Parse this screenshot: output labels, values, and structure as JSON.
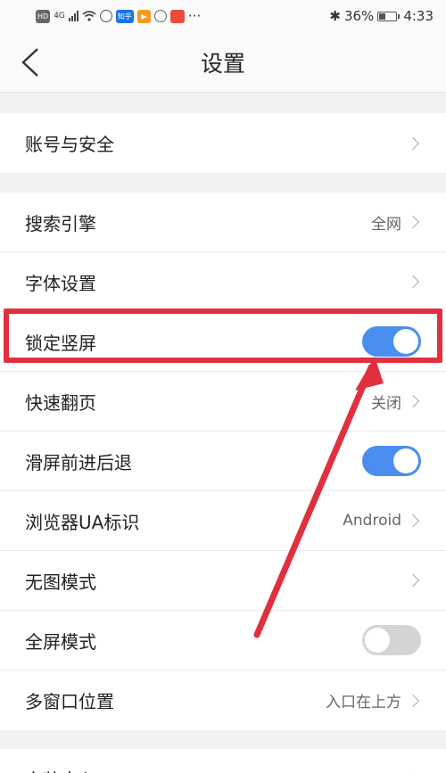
{
  "status_bar": {
    "left_icons": [
      "hd-icon",
      "4g-icon",
      "signal-icon",
      "wifi-icon",
      "nfc-icon",
      "zhihu-app-icon",
      "play-app-icon",
      "app-icon",
      "app-icon",
      "more-icon"
    ],
    "zhihu_label": "知乎",
    "more": "···",
    "hd": "HD",
    "net": "4G",
    "battery_percent": "36%",
    "time": "4:33"
  },
  "header": {
    "title": "设置"
  },
  "groups": [
    {
      "rows": [
        {
          "label": "账号与安全",
          "value": "",
          "control": "chevron"
        }
      ]
    },
    {
      "rows": [
        {
          "label": "搜索引擎",
          "value": "全网",
          "control": "chevron"
        },
        {
          "label": "字体设置",
          "value": "",
          "control": "chevron"
        },
        {
          "label": "锁定竖屏",
          "value": "",
          "control": "toggle",
          "on": true
        },
        {
          "label": "快速翻页",
          "value": "关闭",
          "control": "chevron"
        },
        {
          "label": "滑屏前进后退",
          "value": "",
          "control": "toggle",
          "on": true
        },
        {
          "label": "浏览器UA标识",
          "value": "Android",
          "control": "chevron"
        },
        {
          "label": "无图模式",
          "value": "",
          "control": "chevron"
        },
        {
          "label": "全屏模式",
          "value": "",
          "control": "toggle",
          "on": false
        },
        {
          "label": "多窗口位置",
          "value": "入口在上方",
          "control": "chevron"
        }
      ]
    },
    {
      "rows": [
        {
          "label": "安装中心",
          "value": "",
          "control": "chevron"
        }
      ]
    }
  ],
  "colors": {
    "accent": "#4a8ef0",
    "annotation": "#e0303e"
  }
}
